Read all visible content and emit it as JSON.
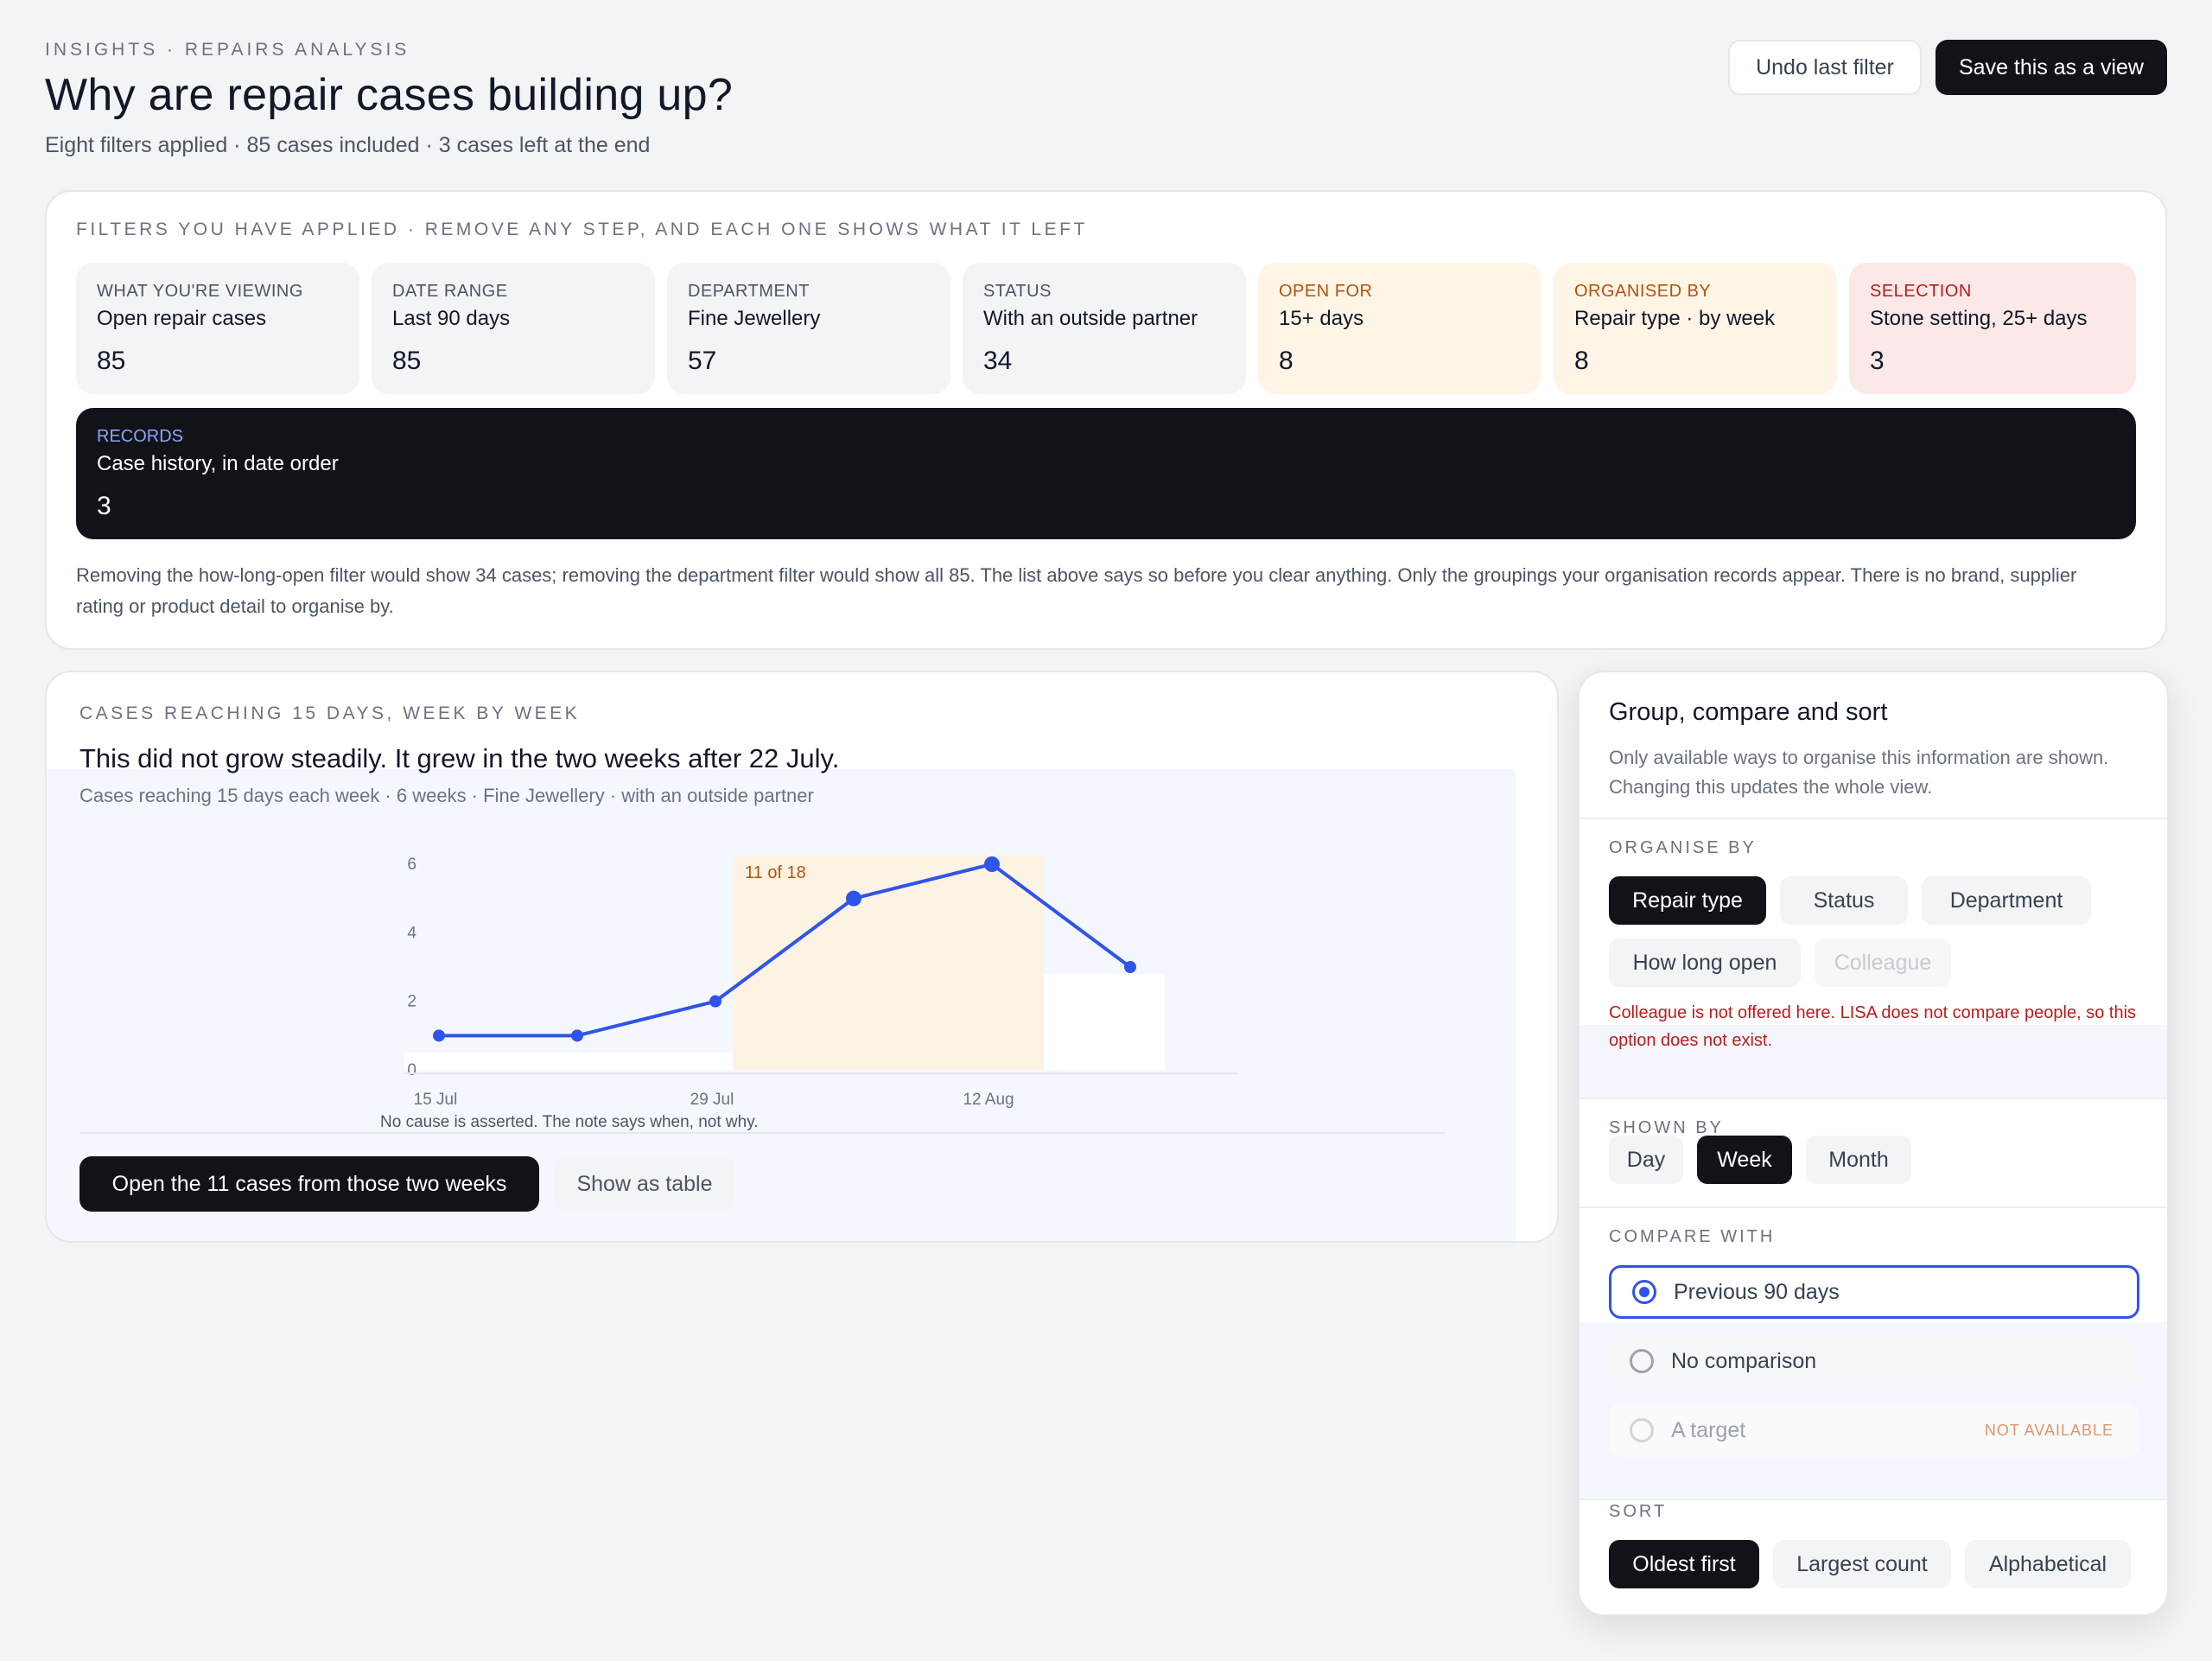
{
  "header": {
    "eyebrow": "INSIGHTS · REPAIRS ANALYSIS",
    "title": "Why are repair cases building up?",
    "subtitle": "Eight filters applied · 85 cases included · 3 cases left at the end",
    "undo_label": "Undo last filter",
    "save_label": "Save this as a view"
  },
  "filters": {
    "section_label": "FILTERS YOU HAVE APPLIED · REMOVE ANY STEP, AND EACH ONE SHOWS WHAT IT LEFT",
    "tiles": [
      {
        "label": "WHAT YOU'RE VIEWING",
        "value": "Open repair cases",
        "count": "85"
      },
      {
        "label": "DATE RANGE",
        "value": "Last 90 days",
        "count": "85"
      },
      {
        "label": "DEPARTMENT",
        "value": "Fine Jewellery",
        "count": "57"
      },
      {
        "label": "STATUS",
        "value": "With an outside partner",
        "count": "34"
      },
      {
        "label": "OPEN FOR",
        "value": "15+ days",
        "count": "8"
      },
      {
        "label": "ORGANISED BY",
        "value": "Repair type · by week",
        "count": "8"
      },
      {
        "label": "SELECTION",
        "value": "Stone setting, 25+ days",
        "count": "3"
      }
    ],
    "records": {
      "label": "RECORDS",
      "value": "Case history, in date order",
      "count": "3"
    },
    "note": "Removing the how-long-open filter would show 34 cases; removing the department filter would show all 85. The list above says so before you clear anything. Only the groupings your organisation records appear. There is no brand, supplier rating or product detail to organise by."
  },
  "chart_card": {
    "section_label": "CASES REACHING 15 DAYS, WEEK BY WEEK",
    "headline": "This did not grow steadily. It grew in the two weeks after 22 July.",
    "subline": "Cases reaching 15 days each week · 6 weeks · Fine Jewellery · with an outside partner",
    "caption": "No cause is asserted. The note says when, not why.",
    "open_label": "Open the 11 cases from those two weeks",
    "table_label": "Show as table"
  },
  "chart_data": {
    "type": "line",
    "title": "",
    "xlabel": "",
    "ylabel": "",
    "x": [
      "15 Jul",
      "22 Jul",
      "29 Jul",
      "5 Aug",
      "12 Aug",
      "19 Aug"
    ],
    "x_tick_labels": [
      "15 Jul",
      "29 Jul",
      "12 Aug"
    ],
    "y_ticks": [
      0,
      2,
      4,
      6
    ],
    "ylim": [
      0,
      6
    ],
    "series": [
      {
        "values": [
          1,
          1,
          2,
          5,
          6,
          3
        ]
      }
    ],
    "highlight": {
      "from": "29 Jul",
      "to": "12 Aug",
      "label": "11 of 18"
    },
    "line_color": "#2f54eb",
    "highlight_color": "#fdf3e4",
    "grid": false
  },
  "panel": {
    "title": "Group, compare and sort",
    "description": "Only available ways to organise this information are shown. Changing this updates the whole view.",
    "organise_label": "ORGANISE BY",
    "organise_options": [
      "Repair type",
      "Status",
      "Department",
      "How long open",
      "Colleague"
    ],
    "warning": "Colleague is not offered here. LISA does not compare people, so this option does not exist.",
    "shown_label": "SHOWN BY",
    "shown_options": [
      "Day",
      "Week",
      "Month"
    ],
    "compare_label": "COMPARE WITH",
    "compare_options": [
      "Previous 90 days",
      "No comparison",
      "A target"
    ],
    "not_available": "NOT AVAILABLE",
    "sort_label": "SORT",
    "sort_options": [
      "Oldest first",
      "Largest count",
      "Alphabetical"
    ]
  },
  "colors": {
    "accent": "#2f54eb",
    "dark": "#111318",
    "warn": "#b91c1c"
  }
}
